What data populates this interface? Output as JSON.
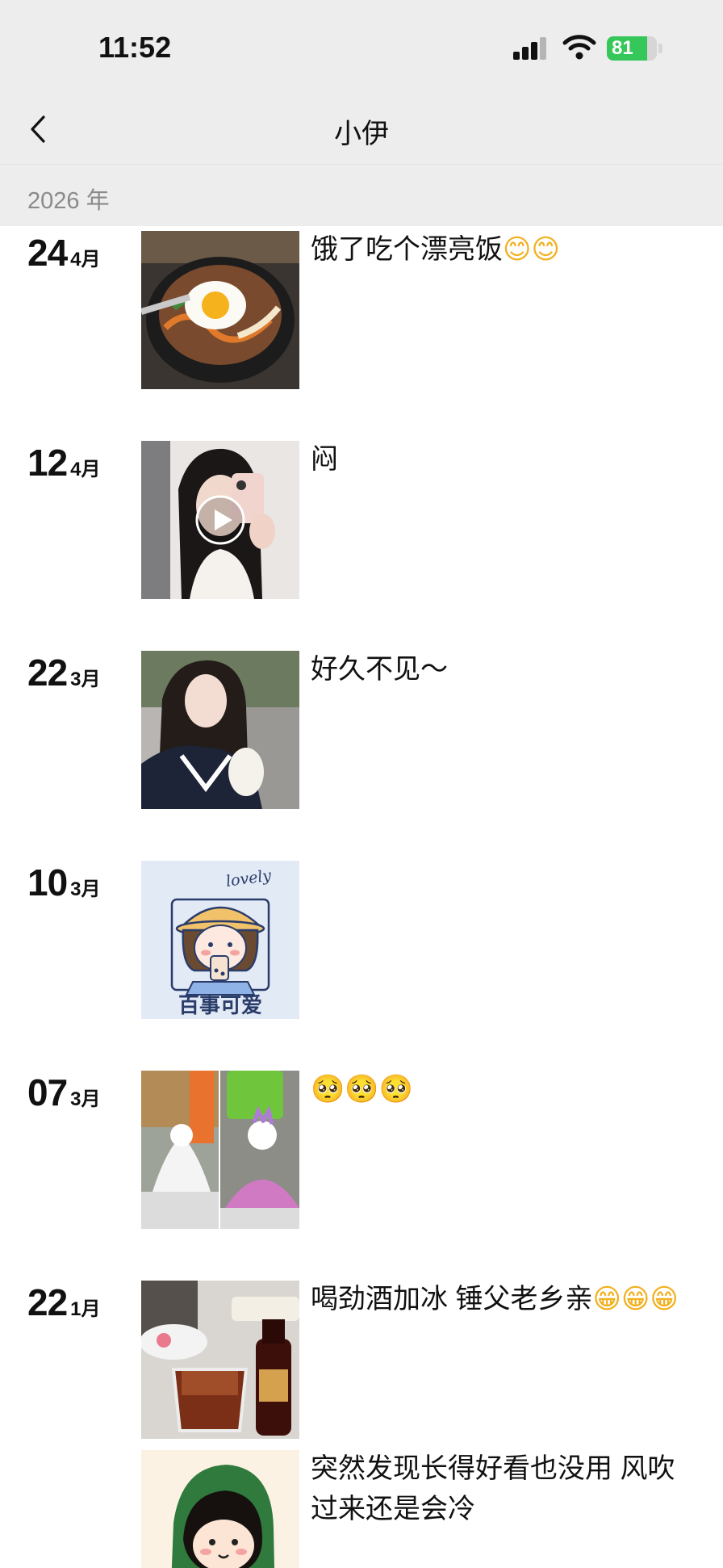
{
  "status_bar": {
    "time": "11:52",
    "battery_percent": 81
  },
  "nav": {
    "title": "小伊"
  },
  "year": {
    "label": "2026 年"
  },
  "entries": [
    {
      "day": "24",
      "month": "4月",
      "caption": "饿了吃个漂亮饭",
      "emoji": "😊😊",
      "thumb": "food-photo"
    },
    {
      "day": "12",
      "month": "4月",
      "caption": "闷",
      "emoji": "",
      "thumb": "video-selfie"
    },
    {
      "day": "22",
      "month": "3月",
      "caption": "好久不见～",
      "emoji": "",
      "thumb": "girl-photo"
    },
    {
      "day": "10",
      "month": "3月",
      "caption": "",
      "emoji": "",
      "thumb": "cartoon-sticker",
      "sticker_top": "lovely",
      "sticker_bottom": "百事可爱"
    },
    {
      "day": "07",
      "month": "3月",
      "caption": "",
      "emoji": "🥺🥺🥺",
      "thumb": "figurine-collage"
    },
    {
      "day": "22",
      "month": "1月",
      "caption": "喝劲酒加冰 锤父老乡亲",
      "emoji": "😁😁😁",
      "thumb": "drink-photo"
    },
    {
      "day": "",
      "month": "",
      "caption": "突然发现长得好看也没用 风吹过来还是会冷",
      "emoji": "",
      "thumb": "cartoon-green-hood"
    }
  ]
}
